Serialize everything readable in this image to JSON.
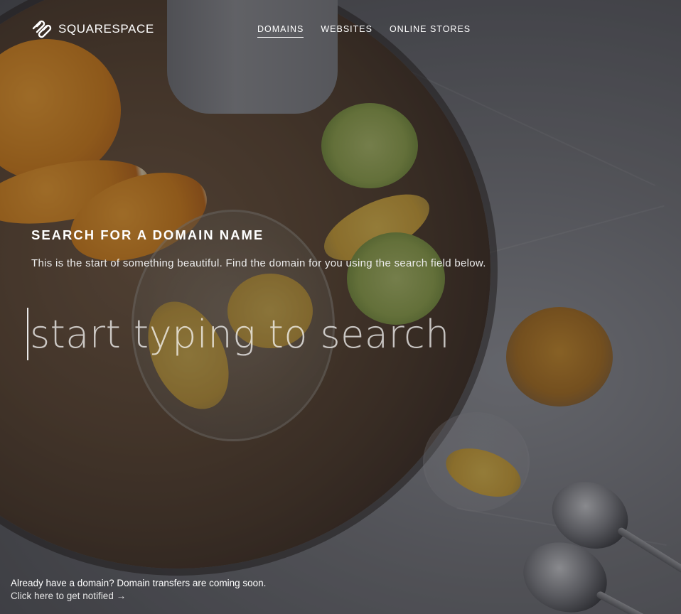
{
  "brand": {
    "name": "SQUARESPACE",
    "logo_icon": "squarespace-logo-icon"
  },
  "nav": {
    "items": [
      {
        "label": "DOMAINS",
        "active": true
      },
      {
        "label": "WEBSITES",
        "active": false
      },
      {
        "label": "ONLINE STORES",
        "active": false
      }
    ]
  },
  "hero": {
    "title": "SEARCH FOR A DOMAIN NAME",
    "subtitle": "This is the start of something beautiful. Find the domain for you using the search field below."
  },
  "search": {
    "placeholder": "start typing to search",
    "value": ""
  },
  "footer": {
    "notice": "Already have a domain? Domain transfers are coming soon.",
    "link_label": "Click here to get notified →"
  }
}
